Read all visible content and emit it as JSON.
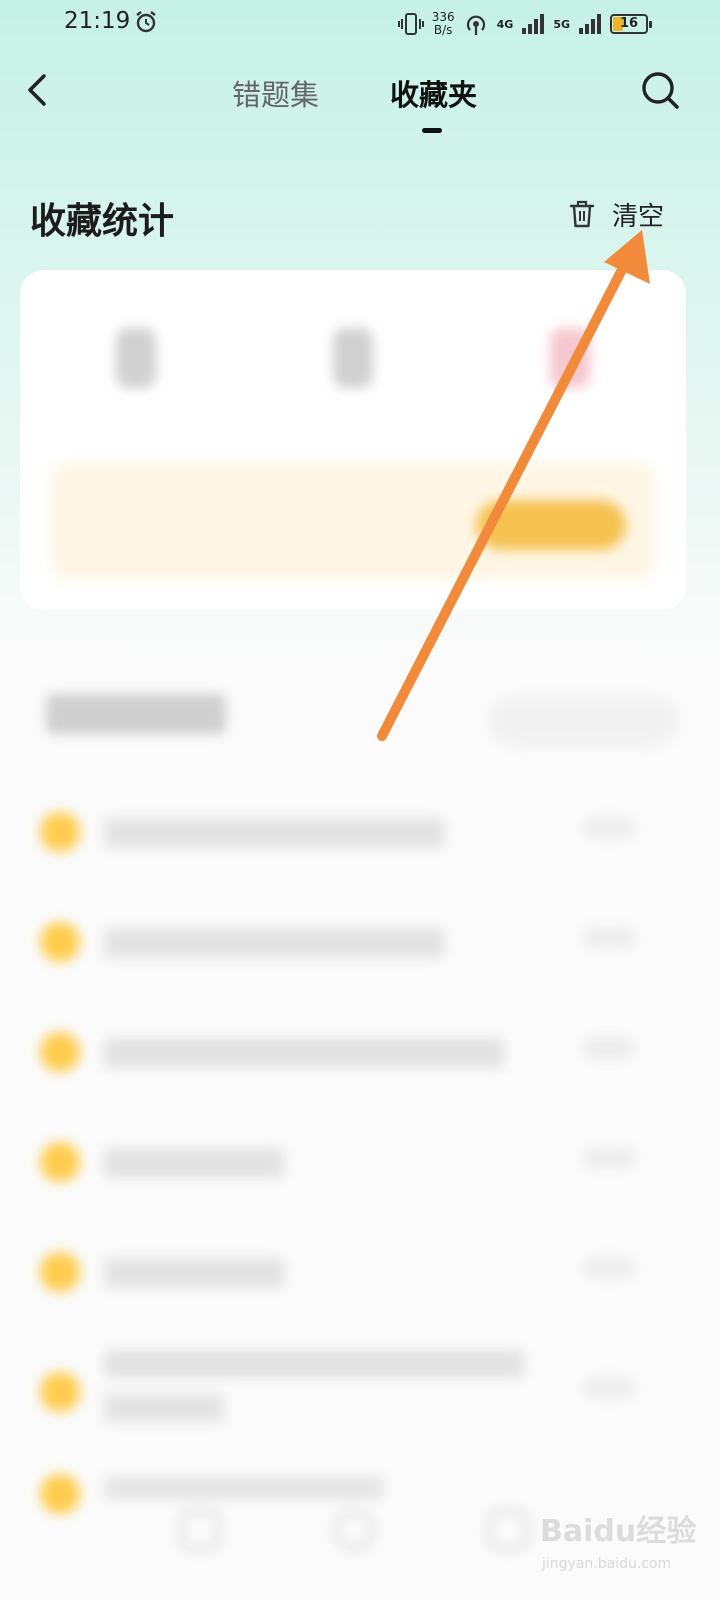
{
  "status_bar": {
    "time": "21:19",
    "net_speed_value": "336",
    "net_speed_unit": "B/s",
    "network_a": "4G",
    "network_b": "5G",
    "battery": "16",
    "icons": [
      "alarm-icon",
      "vibrate-icon",
      "hotspot-icon",
      "signal-icon",
      "battery-icon"
    ]
  },
  "header": {
    "tabs": [
      {
        "label": "错题集",
        "active": false
      },
      {
        "label": "收藏夹",
        "active": true
      }
    ],
    "back_icon": "chevron-left-icon",
    "search_icon": "search-icon"
  },
  "stats": {
    "title": "收藏统计",
    "clear_label": "清空",
    "clear_icon": "trash-icon"
  },
  "colors": {
    "header_bg": "#c6f1e7",
    "annotation_arrow": "#f28a3c",
    "list_dot": "#ffcc4d",
    "promo_bg": "#fff6e6"
  },
  "watermark": {
    "brand": "Baidu经验",
    "url": "jingyan.baidu.com"
  }
}
